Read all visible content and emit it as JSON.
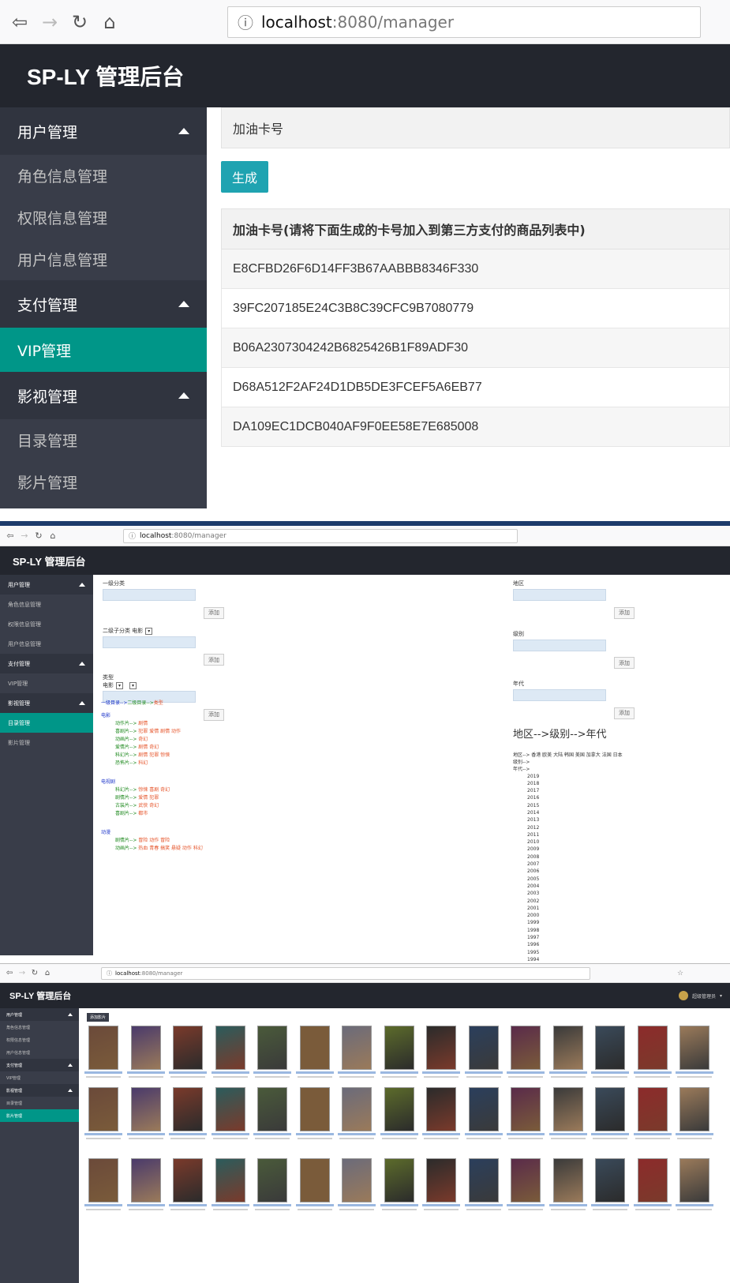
{
  "browser_large": {
    "url_host": "localhost",
    "url_path": ":8080/manager"
  },
  "browser_small": {
    "url_host": "localhost",
    "url_path": ":8080/manager"
  },
  "app_title": "SP-LY 管理后台",
  "sidebar": {
    "user_mgmt": "用户管理",
    "role_info": "角色信息管理",
    "perm_info": "权限信息管理",
    "user_info": "用户信息管理",
    "pay_mgmt": "支付管理",
    "vip_mgmt": "VIP管理",
    "media_mgmt": "影视管理",
    "catalog_mgmt": "目录管理",
    "film_mgmt": "影片管理"
  },
  "card_page": {
    "header": "加油卡号",
    "generate": "生成",
    "table_header": "加油卡号(请将下面生成的卡号加入到第三方支付的商品列表中)",
    "cards": [
      "E8CFBD26F6D14FF3B67AABBB8346F330",
      "39FC207185E24C3B8C39CFC9B7080779",
      "B06A2307304242B6825426B1F89ADF30",
      "D68A512F2AF24D1DB5DE3FCEF5A6EB77",
      "DA109EC1DCB040AF9F0EE58E7E685008"
    ]
  },
  "catalog_page": {
    "first_cat": "一级分类",
    "second_cat": "二级子分类",
    "second_sel": "电影",
    "type_label": "类型",
    "type_sel": "电影",
    "add": "添加",
    "region": "地区",
    "level": "级别",
    "era": "年代",
    "chain_title": "地区-->级别-->年代",
    "region_line": "地区--> 香港 欧美 大陆 韩国 美国 加拿大 法国 日本",
    "level_line": "级别-->",
    "era_line": "年代-->",
    "years": [
      "2019",
      "2018",
      "2017",
      "2016",
      "2015",
      "2014",
      "2013",
      "2012",
      "2011",
      "2010",
      "2009",
      "2008",
      "2007",
      "2006",
      "2005",
      "2004",
      "2003",
      "2002",
      "2001",
      "2000",
      "1999",
      "1998",
      "1997",
      "1996",
      "1995",
      "1994"
    ],
    "tree_title_a": "一级目录-->",
    "tree_title_b": "二级目录-->",
    "tree_title_c": "类型",
    "movie": "电影",
    "tv": "电视剧",
    "anime": "动漫",
    "movie_rows": [
      {
        "k": "动作片-->",
        "v": "剧情"
      },
      {
        "k": "喜剧片-->",
        "v": "犯罪 爱情 剧情 动作"
      },
      {
        "k": "动画片-->",
        "v": "奇幻"
      },
      {
        "k": "爱情片-->",
        "v": "剧情 奇幻"
      },
      {
        "k": "科幻片-->",
        "v": "剧情 犯罪 惊悚"
      },
      {
        "k": "恐怖片-->",
        "v": "科幻"
      }
    ],
    "tv_rows": [
      {
        "k": "科幻片-->",
        "v": "惊悚 喜剧 奇幻"
      },
      {
        "k": "剧情片-->",
        "v": "爱情 犯罪"
      },
      {
        "k": "古装片-->",
        "v": "武侠 奇幻"
      },
      {
        "k": "喜剧片-->",
        "v": "都市"
      }
    ],
    "anime_rows": [
      {
        "k": "剧情片-->",
        "v": "冒险 动作 冒险"
      },
      {
        "k": "动画片-->",
        "v": "热血 青春 搞笑 悬疑 动作 科幻"
      }
    ]
  },
  "film_page": {
    "add_film": "添加影片",
    "admin_label": "超级管理员"
  }
}
